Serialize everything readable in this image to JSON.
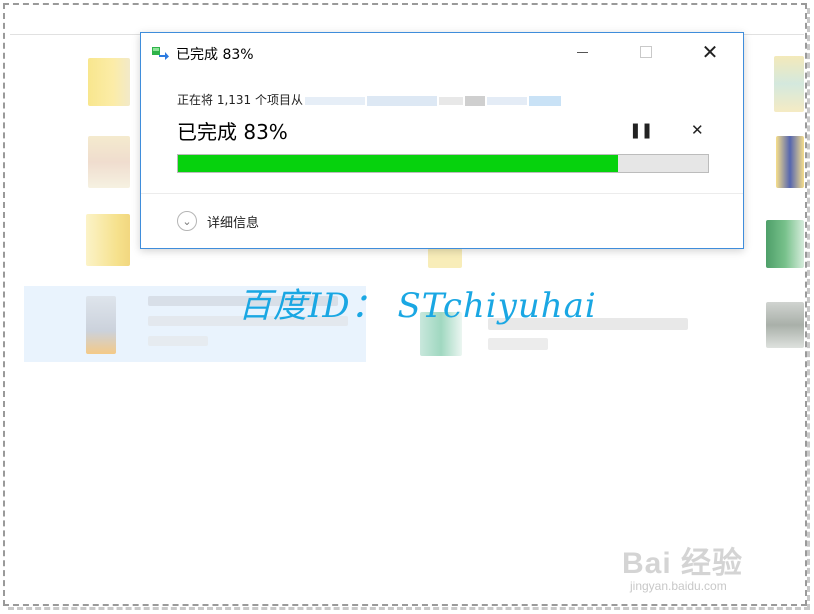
{
  "dialog": {
    "title": "已完成 83%",
    "status_line": "正在将 1,131 个项目从",
    "big_status": "已完成 83%",
    "progress": 0.83,
    "details_label": "详细信息",
    "pause_glyph": "❚❚",
    "cancel_glyph": "✕",
    "progress_color": "#06d20d",
    "border_color": "#3f8ddb"
  },
  "window_buttons": {
    "close_glyph": "✕"
  },
  "watermarks": {
    "author_id": "百度ID：  STchiyuhai",
    "baidu_logo": "Bai 经验",
    "baidu_url": "jingyan.baidu.com"
  },
  "colors": {
    "watermark_blue": "#1aa7e3",
    "selection_bg": "#e9f3fd"
  }
}
